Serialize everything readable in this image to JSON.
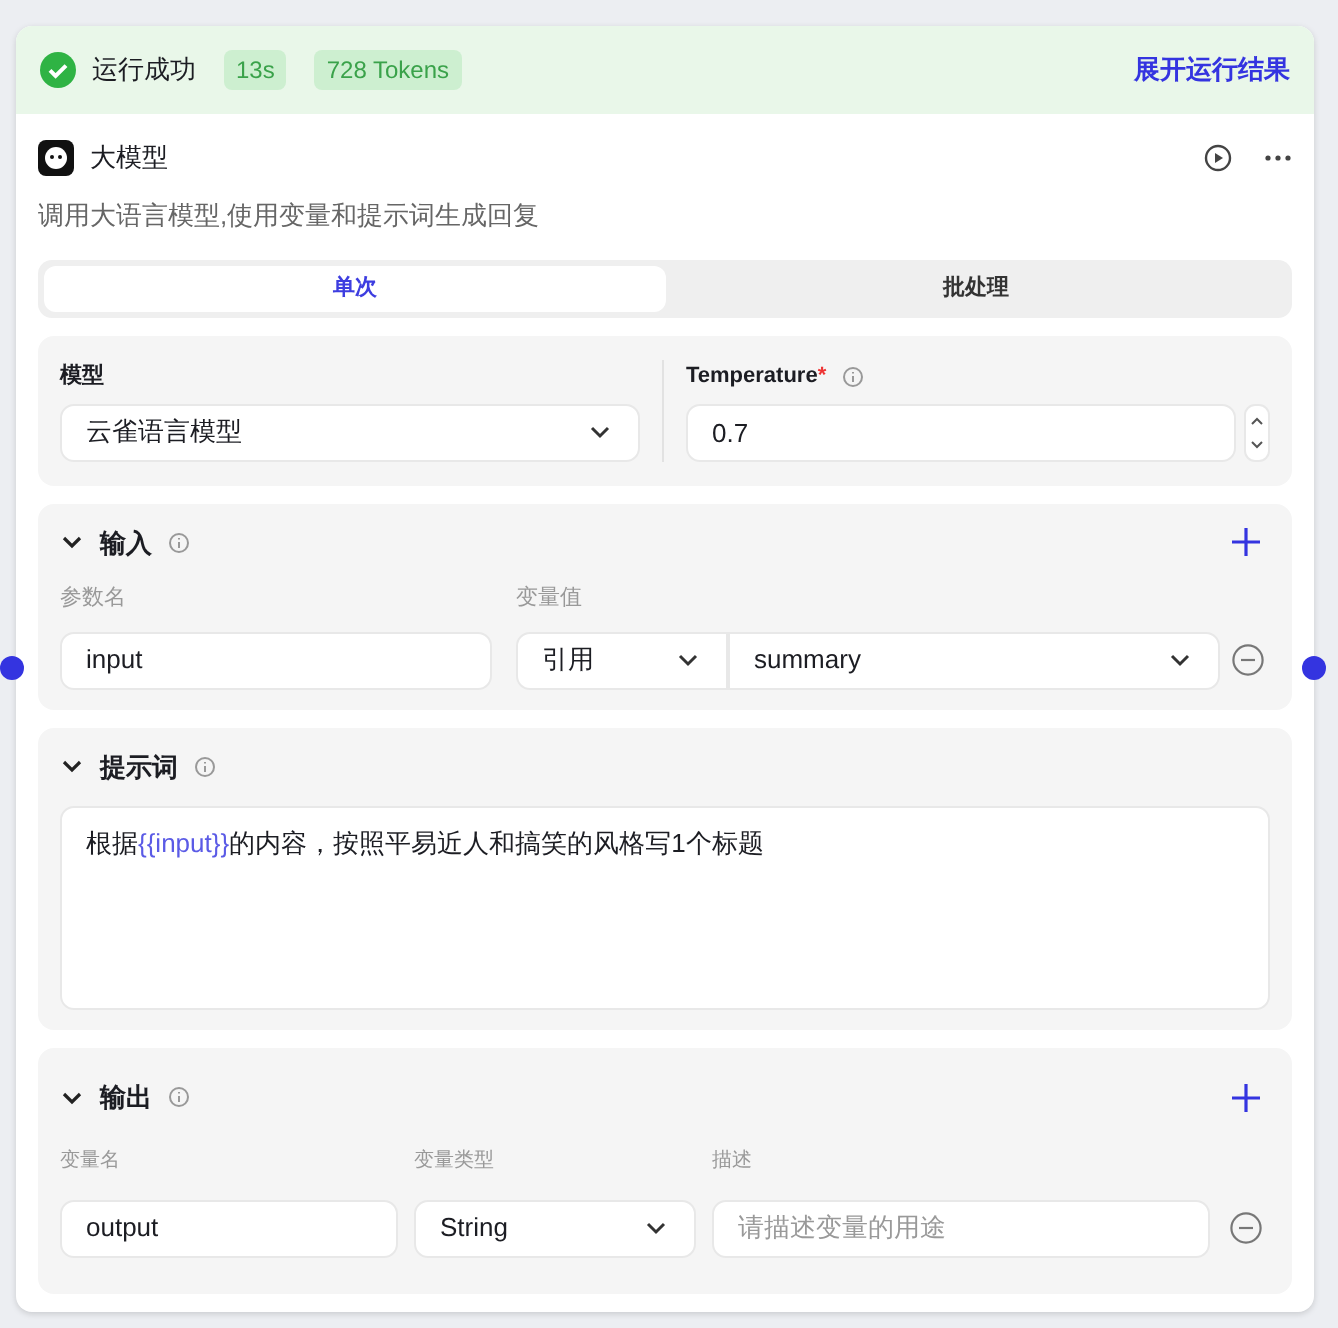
{
  "status": {
    "text": "运行成功",
    "success": true,
    "badges": [
      "13s",
      "728 Tokens"
    ],
    "link": "展开运行结果"
  },
  "node": {
    "title": "大模型",
    "description": "调用大语言模型,使用变量和提示词生成回复"
  },
  "tabs": [
    {
      "label": "单次",
      "selected": true
    },
    {
      "label": "批处理",
      "selected": false
    }
  ],
  "model": {
    "label": "模型",
    "value": "云雀语言模型"
  },
  "temperature": {
    "label": "Temperature",
    "required_mark": "*",
    "value": "0.7"
  },
  "input": {
    "title": "输入",
    "expanded": true,
    "columns": [
      "参数名",
      "变量值"
    ],
    "rows": [
      {
        "name": "input",
        "source": "引用",
        "value": "summary"
      }
    ]
  },
  "prompt": {
    "title": "提示词",
    "expanded": true,
    "segments": [
      {
        "kind": "text",
        "text": "根据"
      },
      {
        "kind": "variable",
        "text": "{{input}}"
      },
      {
        "kind": "text",
        "text": "的内容，按照平易近人和搞笑的风格写1个标题"
      }
    ]
  },
  "output": {
    "title": "输出",
    "expanded": true,
    "columns": [
      "变量名",
      "变量类型",
      "描述"
    ],
    "rows": [
      {
        "name": "output",
        "type": "String",
        "placeholder": "请描述变量的用途"
      }
    ]
  }
}
